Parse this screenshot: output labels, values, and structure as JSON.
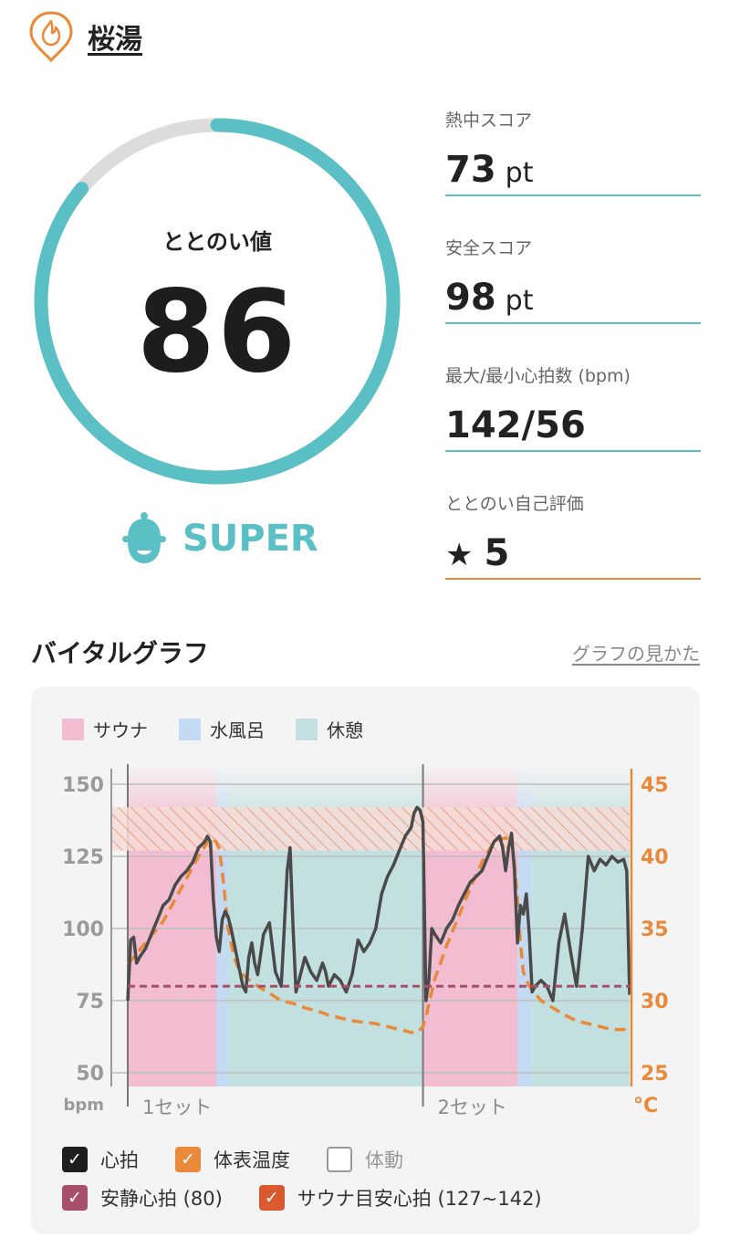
{
  "header": {
    "facility_name": "桜湯",
    "icon": "flame-location-pin-icon"
  },
  "gauge": {
    "label": "ととのい値",
    "value": "86",
    "progress_percent": 86,
    "color": "#5bbfc6",
    "track_color": "#dcdcdc"
  },
  "rank": {
    "icon": "sauna-hat-face-icon",
    "label": "SUPER"
  },
  "metrics": [
    {
      "label": "熱中スコア",
      "value": "73",
      "unit": "pt"
    },
    {
      "label": "安全スコア",
      "value": "98",
      "unit": "pt"
    },
    {
      "label": "最大/最小心拍数 (bpm)",
      "value": "142/56",
      "unit": ""
    },
    {
      "label": "ととのい自己評価",
      "star": "★",
      "value": "5",
      "unit": ""
    }
  ],
  "vital": {
    "title": "バイタルグラフ",
    "howto_link": "グラフの見かた"
  },
  "legend": [
    {
      "label": "サウナ",
      "color": "#f2bdd0"
    },
    {
      "label": "水風呂",
      "color": "#c4daf3"
    },
    {
      "label": "休憩",
      "color": "#c3e0e0"
    }
  ],
  "chart_data": {
    "type": "line",
    "left_axis": {
      "unit": "bpm",
      "ticks": [
        "150",
        "125",
        "100",
        "75",
        "50"
      ],
      "range": [
        50,
        150
      ]
    },
    "right_axis": {
      "unit": "°C",
      "ticks": [
        "45",
        "40",
        "35",
        "30",
        "25"
      ],
      "range": [
        25,
        45
      ]
    },
    "set_labels": [
      "1セット",
      "2セット"
    ],
    "phases": [
      {
        "phase": "サウナ",
        "start": 0,
        "end": 30
      },
      {
        "phase": "水風呂",
        "start": 30,
        "end": 34
      },
      {
        "phase": "休憩",
        "start": 34,
        "end": 100
      },
      {
        "phase": "サウナ",
        "start": 100,
        "end": 132
      },
      {
        "phase": "水風呂",
        "start": 132,
        "end": 137
      },
      {
        "phase": "休憩",
        "start": 137,
        "end": 170
      }
    ],
    "resting_heart_rate": 80,
    "sauna_target_range": [
      127,
      142
    ],
    "series": [
      {
        "name": "心拍",
        "color": "#4a4a4a",
        "x": [
          0,
          1,
          2,
          3,
          4,
          6,
          8,
          10,
          12,
          14,
          16,
          18,
          20,
          22,
          24,
          26,
          27,
          28,
          29,
          30,
          31,
          32,
          33,
          34,
          35,
          36,
          38,
          39,
          40,
          41,
          42,
          43,
          44,
          46,
          48,
          50,
          52,
          53,
          54,
          55,
          56,
          57,
          58,
          60,
          62,
          64,
          66,
          67,
          68,
          69,
          70,
          72,
          74,
          76,
          78,
          80,
          82,
          84,
          86,
          88,
          90,
          92,
          94,
          96,
          97,
          98,
          99,
          100,
          101,
          102,
          103,
          104,
          106,
          108,
          110,
          112,
          114,
          116,
          118,
          120,
          122,
          124,
          126,
          127,
          128,
          129,
          130,
          131,
          132,
          133,
          134,
          135,
          136,
          137,
          138,
          140,
          142,
          144,
          146,
          148,
          150,
          152,
          154,
          156,
          158,
          160,
          162,
          164,
          166,
          168,
          169,
          170
        ],
        "y": [
          75,
          96,
          97,
          88,
          90,
          93,
          98,
          103,
          108,
          110,
          115,
          118,
          120,
          123,
          128,
          130,
          132,
          130,
          110,
          97,
          92,
          103,
          106,
          104,
          100,
          95,
          85,
          80,
          78,
          90,
          95,
          88,
          84,
          98,
          102,
          85,
          80,
          100,
          120,
          128,
          100,
          78,
          82,
          90,
          85,
          82,
          88,
          85,
          80,
          82,
          84,
          82,
          78,
          84,
          96,
          92,
          95,
          100,
          112,
          118,
          122,
          127,
          132,
          135,
          140,
          142,
          141,
          137,
          75,
          82,
          100,
          98,
          95,
          100,
          103,
          108,
          112,
          116,
          118,
          120,
          125,
          130,
          132,
          128,
          120,
          128,
          133,
          120,
          95,
          108,
          105,
          112,
          98,
          78,
          80,
          82,
          80,
          75,
          95,
          105,
          92,
          80,
          100,
          125,
          120,
          124,
          122,
          125,
          123,
          124,
          120,
          77
        ]
      },
      {
        "name": "体表温度",
        "color": "#e98a3a",
        "x": [
          0,
          4,
          8,
          12,
          16,
          20,
          24,
          28,
          30,
          31,
          32,
          33,
          34,
          36,
          38,
          40,
          44,
          48,
          52,
          56,
          60,
          64,
          68,
          72,
          76,
          80,
          84,
          88,
          92,
          96,
          98,
          100,
          101,
          102,
          104,
          108,
          112,
          116,
          120,
          124,
          128,
          130,
          131,
          132,
          133,
          134,
          136,
          138,
          140,
          144,
          148,
          152,
          156,
          160,
          164,
          168,
          170
        ],
        "y": [
          32.5,
          33.5,
          34.5,
          35.5,
          37,
          38.5,
          40,
          41.3,
          41,
          40.5,
          39,
          37,
          35,
          33,
          32,
          31.6,
          31,
          30.5,
          30,
          29.8,
          29.5,
          29.3,
          29,
          28.8,
          28.6,
          28.5,
          28.4,
          28.2,
          28,
          27.8,
          27.8,
          28.2,
          28.8,
          29.8,
          31.5,
          33.8,
          35.8,
          37.8,
          39.6,
          41,
          41.3,
          41,
          39.5,
          37,
          34,
          32,
          31,
          30.5,
          30,
          29.5,
          29,
          28.6,
          28.4,
          28.2,
          28,
          28,
          28.2
        ]
      }
    ]
  },
  "checks": [
    {
      "label": "心拍",
      "color": "#1e1e1e",
      "checked": true
    },
    {
      "label": "体表温度",
      "color": "#e98a3a",
      "checked": true
    },
    {
      "label": "体動",
      "color": "",
      "checked": false
    },
    {
      "label": "安静心拍 (80)",
      "color": "#a8506a",
      "checked": true
    },
    {
      "label": "サウナ目安心拍 (127~142)",
      "color": "#d95a2e",
      "checked": true
    }
  ]
}
